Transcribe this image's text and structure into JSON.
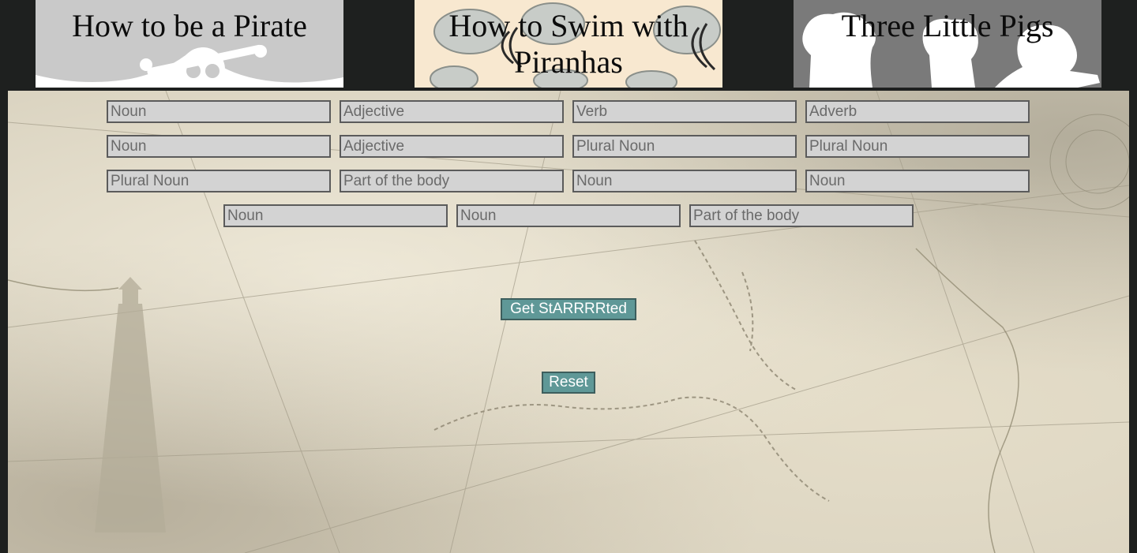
{
  "nav": {
    "tabs": [
      {
        "label": "How to be a Pirate"
      },
      {
        "label": "How to Swim with Piranhas"
      },
      {
        "label": "Three Little Pigs"
      }
    ]
  },
  "form": {
    "rows": [
      [
        "Noun",
        "Adjective",
        "Verb",
        "Adverb"
      ],
      [
        "Noun",
        "Adjective",
        "Plural Noun",
        "Plural Noun"
      ],
      [
        "Plural Noun",
        "Part of the body",
        "Noun",
        "Noun"
      ],
      [
        "Noun",
        "Noun",
        "Part of the body"
      ]
    ]
  },
  "buttons": {
    "start_label": "Get StARRRRted",
    "reset_label": "Reset"
  },
  "colors": {
    "page_background": "#1e201f",
    "button_background": "#5f9897",
    "input_background": "#d3d3d3"
  }
}
